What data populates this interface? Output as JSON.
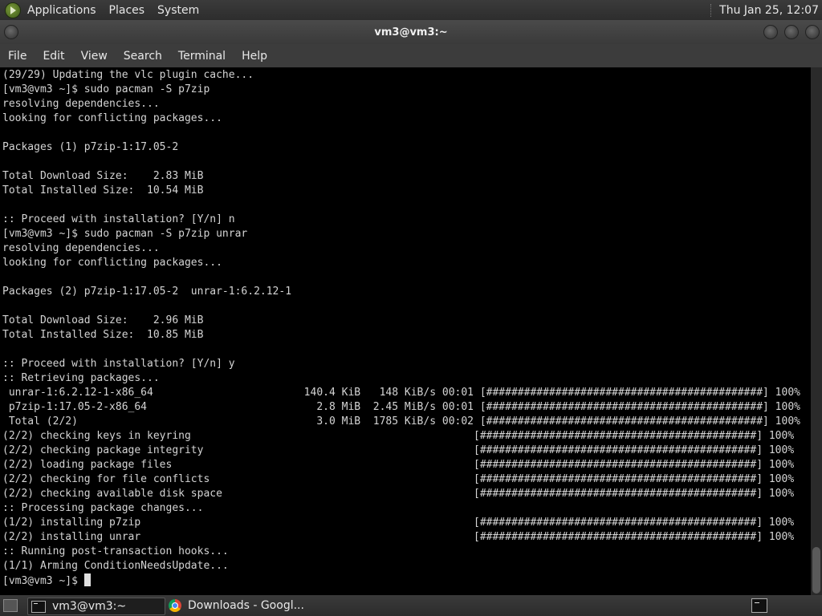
{
  "top_panel": {
    "menus": [
      "Applications",
      "Places",
      "System"
    ],
    "clock": "Thu Jan 25, 12:07"
  },
  "window": {
    "title": "vm3@vm3:~"
  },
  "menubar": {
    "items": [
      "File",
      "Edit",
      "View",
      "Search",
      "Terminal",
      "Help"
    ]
  },
  "terminal": {
    "lines": [
      "(29/29) Updating the vlc plugin cache...",
      "[vm3@vm3 ~]$ sudo pacman -S p7zip",
      "resolving dependencies...",
      "looking for conflicting packages...",
      "",
      "Packages (1) p7zip-1:17.05-2",
      "",
      "Total Download Size:    2.83 MiB",
      "Total Installed Size:  10.54 MiB",
      "",
      ":: Proceed with installation? [Y/n] n",
      "[vm3@vm3 ~]$ sudo pacman -S p7zip unrar",
      "resolving dependencies...",
      "looking for conflicting packages...",
      "",
      "Packages (2) p7zip-1:17.05-2  unrar-1:6.2.12-1",
      "",
      "Total Download Size:    2.96 MiB",
      "Total Installed Size:  10.85 MiB",
      "",
      ":: Proceed with installation? [Y/n] y",
      ":: Retrieving packages...",
      " unrar-1:6.2.12-1-x86_64                        140.4 KiB   148 KiB/s 00:01 [############################################] 100%",
      " p7zip-1:17.05-2-x86_64                           2.8 MiB  2.45 MiB/s 00:01 [############################################] 100%",
      " Total (2/2)                                      3.0 MiB  1785 KiB/s 00:02 [############################################] 100%",
      "(2/2) checking keys in keyring                                             [############################################] 100%",
      "(2/2) checking package integrity                                           [############################################] 100%",
      "(2/2) loading package files                                                [############################################] 100%",
      "(2/2) checking for file conflicts                                          [############################################] 100%",
      "(2/2) checking available disk space                                        [############################################] 100%",
      ":: Processing package changes...",
      "(1/2) installing p7zip                                                     [############################################] 100%",
      "(2/2) installing unrar                                                     [############################################] 100%",
      ":: Running post-transaction hooks...",
      "(1/1) Arming ConditionNeedsUpdate..."
    ],
    "prompt": "[vm3@vm3 ~]$ "
  },
  "taskbar": {
    "items": [
      "vm3@vm3:~",
      "Downloads - Googl..."
    ]
  }
}
